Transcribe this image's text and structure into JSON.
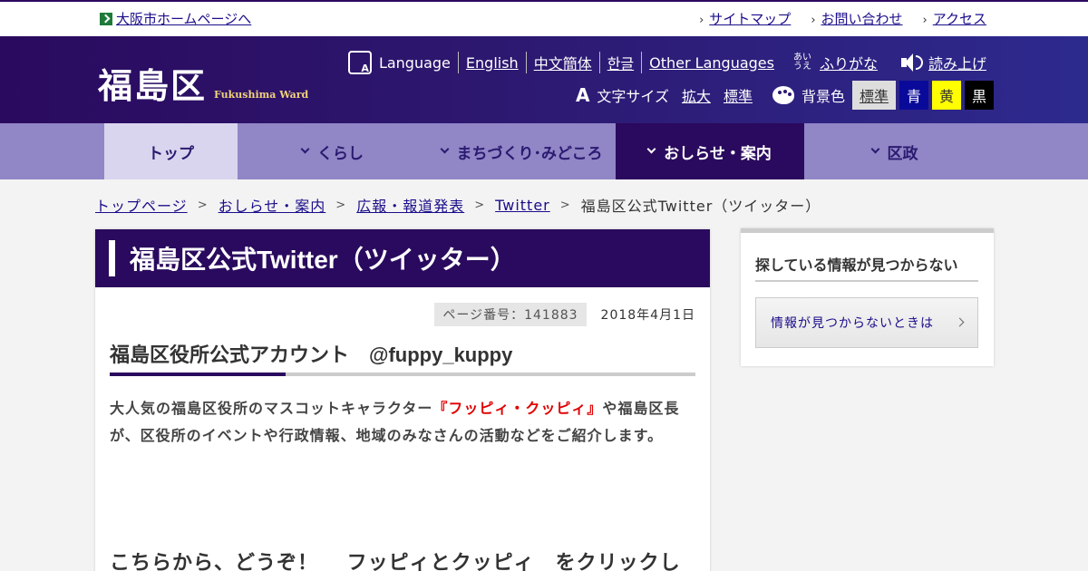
{
  "topbar": {
    "home_link": "大阪市ホームページへ",
    "links": [
      "サイトマップ",
      "お問い合わせ",
      "アクセス"
    ]
  },
  "header": {
    "logo_kanji": "福島区",
    "logo_roman": "Fukushima Ward",
    "language_label": "Language",
    "languages": [
      "English",
      "中文簡体",
      "한글",
      "Other Languages"
    ],
    "furigana_icon": "あい\nうえ",
    "furigana": "ふりがな",
    "read_aloud": "読み上げ",
    "font_size_icon": "A",
    "font_size_label": "文字サイズ",
    "font_size_options": [
      "拡大",
      "標準"
    ],
    "bg_color_label": "背景色",
    "bg_colors": [
      {
        "label": "標準",
        "color": "#dddddd"
      },
      {
        "label": "青",
        "color": "#0a0a9a"
      },
      {
        "label": "黄",
        "color": "#ffff00"
      },
      {
        "label": "黒",
        "color": "#000000"
      }
    ]
  },
  "nav": {
    "items": [
      "トップ",
      "くらし",
      "まちづくり･みどころ",
      "おしらせ・案内",
      "区政"
    ],
    "active_index": 3
  },
  "breadcrumb": [
    "トップページ",
    "おしらせ・案内",
    "広報・報道発表",
    "Twitter",
    "福島区公式Twitter（ツイッター）"
  ],
  "main": {
    "title": "福島区公式Twitter（ツイッター）",
    "page_number": "ページ番号：141883",
    "date": "2018年4月1日",
    "heading": "福島区役所公式アカウント　@fuppy_kuppy",
    "intro_before": "大人気の福島区役所のマスコットキャラクター",
    "intro_highlight": "『フッピィ・クッピィ』",
    "intro_after": "や福島区長が、区役所のイベントや行政情報、地域のみなさんの活動などをご紹介します。",
    "subheading": "こちらから、どうぞ！　 フッピィとクッピィ　をクリックし"
  },
  "side": {
    "heading": "探している情報が見つからない",
    "button": "情報が見つからないときは"
  },
  "colors": {
    "brand_dark": "#2a0a5e",
    "nav_bg": "#9186c6",
    "highlight_red": "#e00000"
  }
}
